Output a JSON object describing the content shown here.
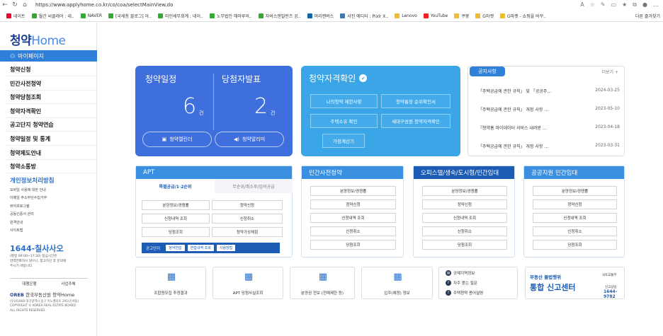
{
  "browser": {
    "url": "https://www.applyhome.co.kr/co/coa/selectMainView.do",
    "back_icon": "back-arrow-icon",
    "reload_icon": "reload-icon"
  },
  "bookmarks": [
    {
      "label": "네이트",
      "color": "#e03"
    },
    {
      "label": "월간 씨클레어 : 네..",
      "color": "#3a3"
    },
    {
      "label": "NAVER",
      "color": "#3a3"
    },
    {
      "label": "[국세청 블로그] 아..",
      "color": "#3a3"
    },
    {
      "label": "미인세무회계 : 네이..",
      "color": "#3a3"
    },
    {
      "label": "노무법인 해마루의..",
      "color": "#3a3"
    },
    {
      "label": "자비스앤빌런즈 공..",
      "color": "#3a3"
    },
    {
      "label": "머리캔버스",
      "color": "#16a"
    },
    {
      "label": "사진 에디터 : Pixlr X..",
      "color": "#47a"
    },
    {
      "label": "Lenovo",
      "color": "#eb3"
    },
    {
      "label": "YouTube",
      "color": "#e22"
    },
    {
      "label": "쿠팡",
      "color": "#eb3"
    },
    {
      "label": "G마켓",
      "color": "#eb3"
    },
    {
      "label": "G마켓 - 쇼핑을 바꾸..",
      "color": "#eb3"
    }
  ],
  "bookmarks_more": "다른 즐겨찾기",
  "sidebar": {
    "logo_a": "청약",
    "logo_b": "Home",
    "mypage": "마이페이지",
    "items": [
      "청약신청",
      "민간사전청약",
      "청약당첨조회",
      "청약자격확인",
      "공고단지 청약연습",
      "청약일정 및 통계",
      "청약제도안내",
      "청약소통방"
    ],
    "privacy_title": "개인정보처리방침",
    "privacy_items": [
      "모바일 사용에 대한 안내",
      "이메일 주소무단수집거부",
      "뷰어프로그램",
      "공동인증서 관리",
      "원격안내",
      "사이트맵"
    ],
    "callcenter": "1644-칠사사오",
    "cc_lines": [
      "(평일 09:00~17:30) 점심시간은",
      "번역전화하시 않으니, 참고하신 후 문의해",
      "주시기 바랍니다."
    ],
    "bottom_btns": [
      "대행은행",
      "사업주체"
    ],
    "foot_logo": "한국부동산원 청약Home",
    "foot_lines": [
      "(우)41068 대구광역시 동구 이노밸리로 291(신서동)",
      "COPYRIGHT © KOREA REAL ESTATE BOARD.",
      "ALL RIGHTS RESERVED."
    ]
  },
  "schedule": {
    "title_left": "청약일정",
    "title_right": "당첨자발표",
    "count_left": "6",
    "count_right": "2",
    "unit": "건",
    "btn_calendar": "청약캘린더",
    "btn_alarm": "청약알리미"
  },
  "qualification": {
    "title": "청약자격확인",
    "buttons": [
      "나의청약 제한사항",
      "청약통장 순위확인서",
      "주택소유 확인",
      "세대구성원 청약자격확인",
      "가점계산기"
    ]
  },
  "notice": {
    "tab": "공지사항",
    "more": "더보기 +",
    "rows": [
      {
        "title": "「주택공급에 관한 규칙」 및 「공공주…",
        "date": "2024-03-25"
      },
      {
        "title": "「주택공급에 관한 규칙」 개정 사항 …",
        "date": "2023-05-10"
      },
      {
        "title": "『청약홈 마이데이터 서비스 내려받 …",
        "date": "2023-04-18"
      },
      {
        "title": "「주택공급에 관한 규칙」 개정 사항 …",
        "date": "2023-03-31"
      }
    ]
  },
  "apt": {
    "title": "APT",
    "subtab_active": "특별공급/1·2순위",
    "subtab_other": "무순위/취소후/임의공급",
    "buttons": [
      "분양정보/경쟁률",
      "청약신청",
      "신청내역 조회",
      "신청취소",
      "당첨조회",
      "청약가상체험"
    ],
    "bar_label": "공고단지",
    "bar_pills": [
      "청약연습",
      "연습내역 조회",
      "사용방법"
    ]
  },
  "cards": [
    {
      "title": "민간사전청약",
      "color": "#3a8fe0",
      "buttons": [
        "분양정보/경쟁률",
        "청약신청",
        "신청내역 조회",
        "신청취소",
        "당첨조회"
      ]
    },
    {
      "title": "오피스텔/생숙/도시형/민간임대",
      "color": "#1c5cb5",
      "buttons": [
        "분양정보/경쟁률",
        "청약신청",
        "신청내역 조회",
        "신청취소",
        "당첨조회"
      ]
    },
    {
      "title": "공공지원 민간임대",
      "color": "#3a8fe0",
      "buttons": [
        "분양정보/경쟁률",
        "청약신청",
        "신청내역 조회",
        "신청취소",
        "당첨조회"
      ]
    }
  ],
  "bottom_links": [
    {
      "label": "조합원모집 추정결과",
      "icon": "calculator-icon"
    },
    {
      "label": "APT 당첨사실조회",
      "icon": "apartment-icon"
    },
    {
      "label": "분양권 전보 (전매제한 등)",
      "icon": "document-search-icon"
    },
    {
      "label": "입주(예정) 정보",
      "icon": "building-people-icon"
    }
  ],
  "quick": [
    {
      "label": "규제지역정보",
      "icon": "map-icon"
    },
    {
      "label": "자주 묻는 질문",
      "icon": "question-icon"
    },
    {
      "label": "주택청약 용어설명",
      "icon": "book-icon"
    }
  ],
  "report": {
    "line1": "부동산 불법행위",
    "line2": "통합 신고센터",
    "ministry": "국토교통부",
    "label": "신고상담",
    "phone": "1644-9782"
  }
}
